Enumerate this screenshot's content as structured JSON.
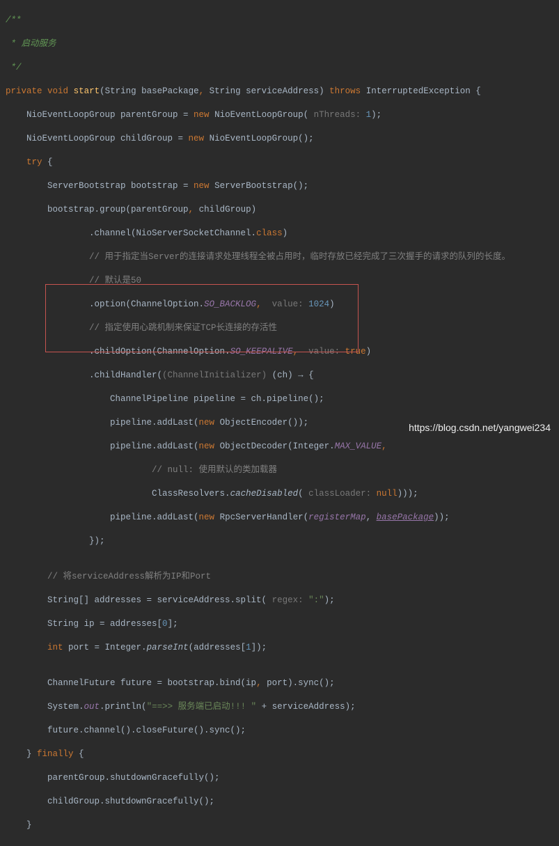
{
  "doc": {
    "open": "/**",
    "line1": "* 启动服务",
    "close": "*/"
  },
  "sig": {
    "private": "private",
    "void": "void",
    "start": "start",
    "open_paren": "(String basePackage",
    "comma1": ",",
    "arg2": " String serviceAddress)",
    "throws": "throws",
    "ex": " InterruptedException {"
  },
  "l1": {
    "a": "    NioEventLoopGroup parentGroup = ",
    "new": "new",
    "b": " NioEventLoopGroup(",
    "hint": " nThreads: ",
    "num": "1",
    "c": ");"
  },
  "l2": {
    "a": "    NioEventLoopGroup childGroup = ",
    "new": "new",
    "b": " NioEventLoopGroup();"
  },
  "try": "try",
  "try_open": " {",
  "l3": {
    "a": "        ServerBootstrap bootstrap = ",
    "new": "new",
    "b": " ServerBootstrap();"
  },
  "l4": "        bootstrap.group(parentGroup",
  "l4c": ",",
  "l4b": " childGroup)",
  "l5": "                .channel(NioServerSocketChannel.",
  "l5cls": "class",
  "l5end": ")",
  "c1": "                // 用于指定当Server的连接请求处理线程全被占用时，临时存放已经完成了三次握手的请求的队列的长度。",
  "c2": "                // 默认是50",
  "l6": {
    "a": "                .option(ChannelOption.",
    "f": "SO_BACKLOG",
    "c": ",",
    "hint": "  value: ",
    "num": "1024",
    "e": ")"
  },
  "c3": "                // 指定使用心跳机制来保证TCP长连接的存活性",
  "l7": {
    "a": "                .childOption(ChannelOption.",
    "f": "SO_KEEPALIVE",
    "c": ",",
    "hint": "  value: ",
    "kw": "true",
    "e": ")"
  },
  "l8": {
    "a": "                .childHandler(",
    "hint": "(ChannelInitializer) ",
    "b": "(ch) → {"
  },
  "l9": "                    ChannelPipeline pipeline = ch.pipeline();",
  "l10": {
    "a": "                    pipeline.addLast(",
    "new": "new",
    "b": " ObjectEncoder());"
  },
  "l11": {
    "a": "                    pipeline.addLast(",
    "new": "new",
    "b": " ObjectDecoder(Integer.",
    "f": "MAX_VALUE",
    "c": ","
  },
  "c4": "                            // null: 使用默认的类加载器",
  "l12": {
    "a": "                            ClassResolvers.",
    "m": "cacheDisabled",
    "b": "(",
    "hint": " classLoader: ",
    "kw": "null",
    "c": ")));"
  },
  "l13": {
    "a": "                    pipeline.addLast(",
    "new": "new",
    "b": " RpcServerHandler(",
    "f1": "registerMap",
    "c": ", ",
    "f2": "basePackage",
    "d": "));"
  },
  "l14": "                });",
  "blank": "",
  "c5": "        // 将serviceAddress解析为IP和Port",
  "l15": {
    "a": "        String[] addresses = serviceAddress.split(",
    "hint": " regex: ",
    "str": "\":\"",
    "b": ");"
  },
  "l16": {
    "a": "        String ip = addresses[",
    "num": "0",
    "b": "];"
  },
  "l17": {
    "a": "        ",
    "kw": "int",
    "b": " port = Integer.",
    "m": "parseInt",
    "c": "(addresses[",
    "num": "1",
    "d": "]);"
  },
  "l18": {
    "a": "        ChannelFuture future = bootstrap.bind(ip",
    "c": ",",
    "b": " port).sync();"
  },
  "l19": {
    "a": "        System.",
    "f": "out",
    "b": ".println(",
    "str": "\"==>> 服务端已启动!!! \"",
    "c": " + serviceAddress);"
  },
  "l20": "        future.channel().closeFuture().sync();",
  "finally_close": "    } ",
  "finally": "finally",
  "finally_open": " {",
  "l21": "        parentGroup.shutdownGracefully();",
  "l22": "        childGroup.shutdownGracefully();",
  "close1": "    }",
  "watermark": "https://blog.csdn.net/yangwei234"
}
